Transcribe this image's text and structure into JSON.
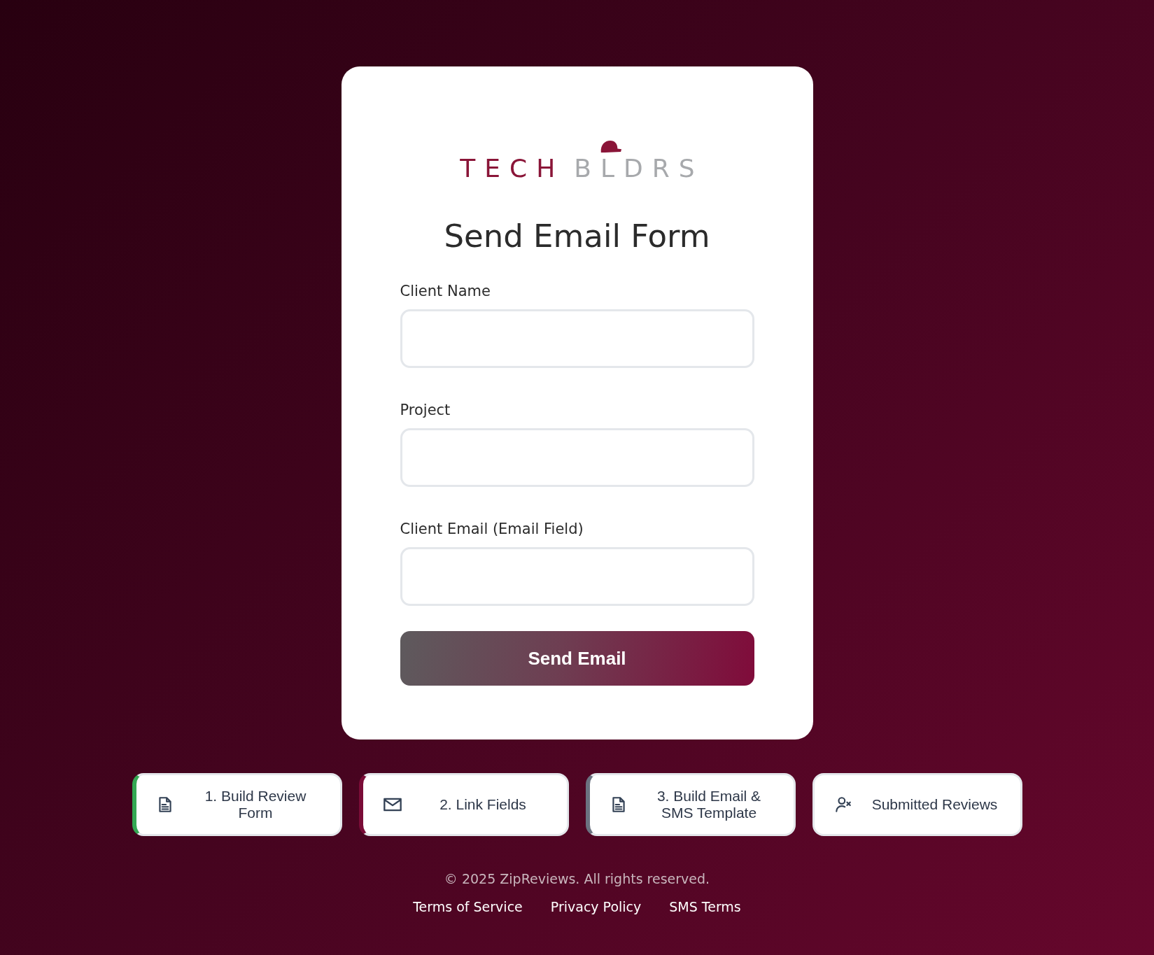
{
  "logo": {
    "part_1": "TECH",
    "part_2": "BLDRS"
  },
  "title": "Send Email Form",
  "fields": [
    {
      "label": "Client Name"
    },
    {
      "label": "Project"
    },
    {
      "label": "Client Email (Email Field)"
    }
  ],
  "submit_button": "Send Email",
  "nav_buttons": [
    {
      "kind": "document",
      "label": "1. Build Review Form",
      "color": "#34a853"
    },
    {
      "kind": "mail",
      "label": "2. Link Fields",
      "color": "#7a0c37"
    },
    {
      "kind": "document",
      "label": "3. Build Email & SMS Template",
      "color": "#6b7280"
    },
    {
      "kind": "person",
      "label": "Submitted Reviews"
    }
  ],
  "footer": {
    "copyright": "© 2025 ZipReviews. All rights reserved.",
    "links": [
      "Terms of Service",
      "Privacy Policy",
      "SMS Terms"
    ]
  }
}
